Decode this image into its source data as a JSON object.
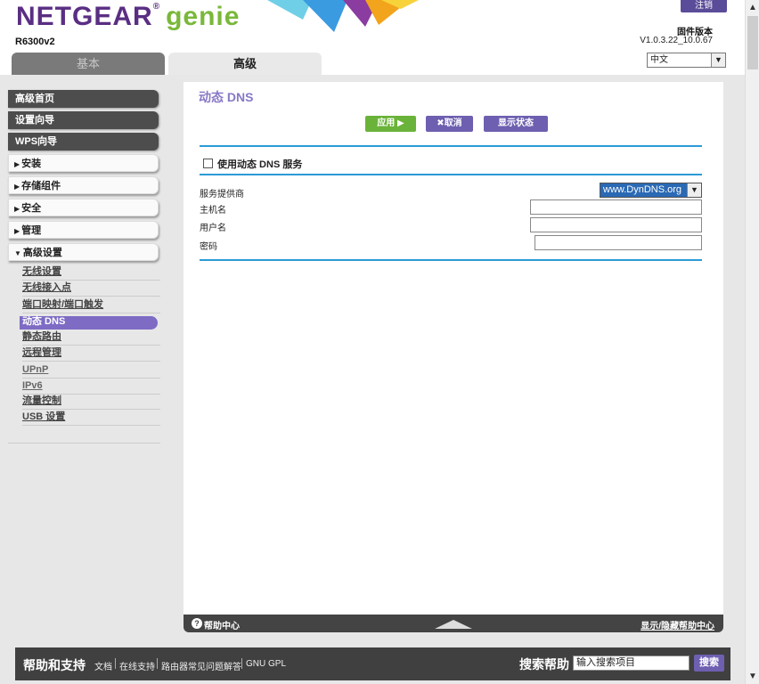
{
  "header": {
    "logo_netgear": "NETGEAR",
    "logo_genie": "genie",
    "logo_reg": "®",
    "model": "R6300v2",
    "logout_label": "注销",
    "firmware_label": "固件版本",
    "firmware_version": "V1.0.3.22_10.0.67",
    "language": "中文"
  },
  "tabs": {
    "basic": "基本",
    "advanced": "高级"
  },
  "sidebar": {
    "home": "高级首页",
    "setup_wizard": "设置向导",
    "wps_wizard": "WPS向导",
    "setup": "安装",
    "storage": "存储组件",
    "security": "安全",
    "admin": "管理",
    "advanced_setup": "高级设置",
    "sub_items": [
      "无线设置",
      "无线接入点",
      "端口映射/端口触发",
      "动态 DNS",
      "静态路由",
      "远程管理",
      "UPnP",
      "IPv6",
      "流量控制",
      "USB 设置"
    ]
  },
  "content": {
    "title": "动态 DNS",
    "apply_label": "应用 ▶",
    "cancel_label": "取消",
    "status_label": "显示状态",
    "use_ddns_label": "使用动态 DNS 服务",
    "provider_label": "服务提供商",
    "provider_value": "www.DynDNS.org",
    "host_label": "主机名",
    "user_label": "用户名",
    "password_label": "密码"
  },
  "help": {
    "center_label": "帮助中心",
    "toggle_label": "显示/隐藏帮助中心"
  },
  "footer": {
    "title": "帮助和支持",
    "links": [
      "文档",
      "在线支持",
      "路由器常见问题解答",
      "GNU GPL"
    ],
    "search_label": "搜索帮助",
    "search_value": "输入搜索项目",
    "search_button": "搜索"
  },
  "colors": {
    "brand_purple": "#5a2e83",
    "genie_green": "#79b83a",
    "accent_purple": "#6e5fb0",
    "apply_green": "#6ab33a",
    "divider_blue": "#2c9ad6"
  }
}
